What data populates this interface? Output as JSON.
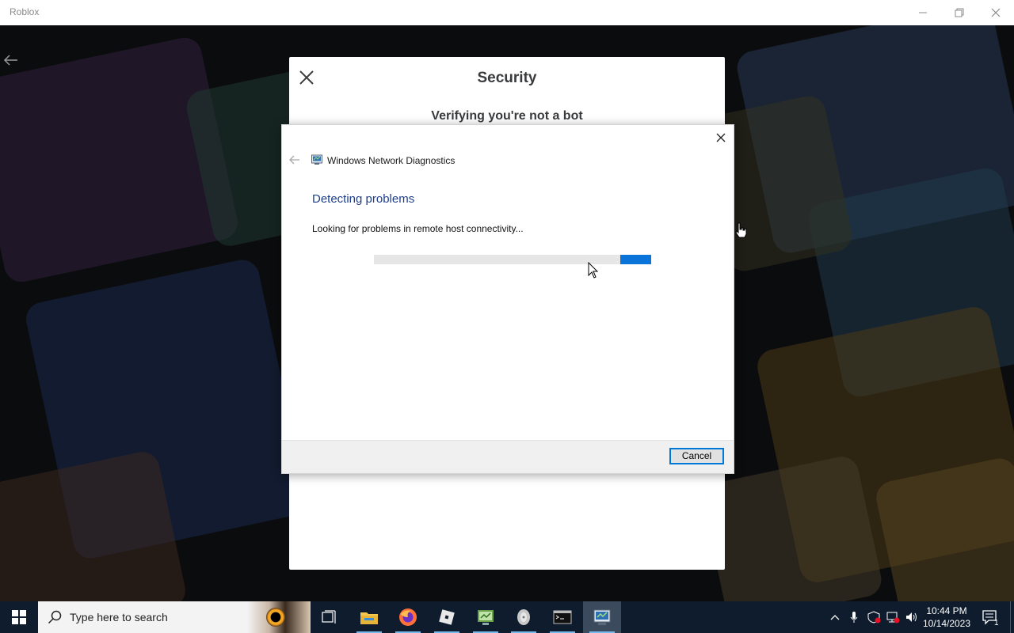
{
  "window": {
    "title": "Roblox"
  },
  "security_panel": {
    "title": "Security",
    "subtitle": "Verifying you're not a bot"
  },
  "diagnostics": {
    "app_title": "Windows Network Diagnostics",
    "heading": "Detecting problems",
    "status": "Looking for problems in remote host connectivity...",
    "progress_state": "indeterminate",
    "cancel_label": "Cancel"
  },
  "taskbar": {
    "search_placeholder": "Type here to search",
    "time": "10:44 PM",
    "date": "10/14/2023",
    "notification_count": "1",
    "pinned": [
      "task-view-icon",
      "file-explorer-icon",
      "firefox-icon",
      "roblox-icon",
      "network-app-icon",
      "hard-drive-icon",
      "terminal-icon",
      "network-diagnostics-icon"
    ]
  },
  "colors": {
    "accent": "#0078d7",
    "heading_blue": "#1e3f8a",
    "taskbar_bg": "#0f1c2e"
  }
}
